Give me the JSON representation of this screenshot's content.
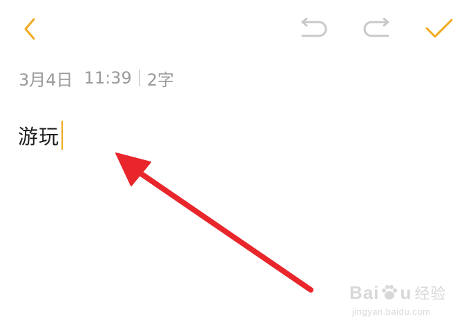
{
  "toolbar": {
    "back_icon": "chevron-left-icon",
    "undo_icon": "undo-icon",
    "redo_icon": "redo-icon",
    "done_icon": "checkmark-icon"
  },
  "note": {
    "date": "3月4日",
    "time": "11:39",
    "char_count": "2字",
    "content": "游玩"
  },
  "colors": {
    "accent": "#f0a91d",
    "disabled_icon": "#c8c8c8",
    "meta_text": "#9a9a9a",
    "annotation_arrow": "#e8262b"
  },
  "watermark": {
    "brand": "Bai",
    "brand_suffix": "u",
    "brand_product": "经验",
    "url": "jingyan.baidu.com"
  }
}
